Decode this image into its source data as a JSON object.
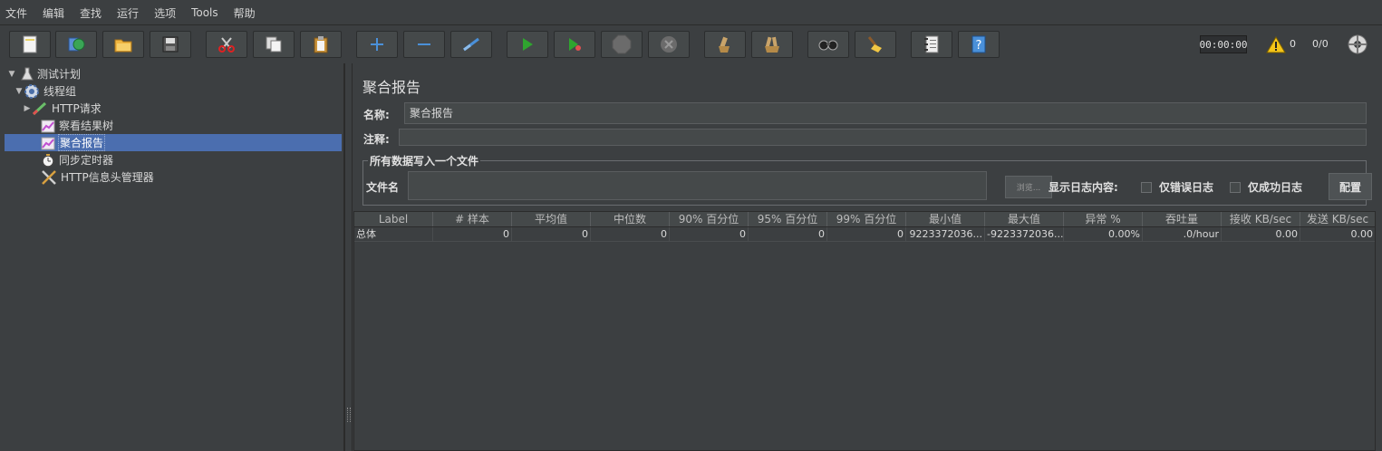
{
  "menu": [
    "文件",
    "编辑",
    "查找",
    "运行",
    "选项",
    "Tools",
    "帮助"
  ],
  "toolbar": {
    "buttons": [
      {
        "name": "new-icon"
      },
      {
        "name": "templates-icon"
      },
      {
        "name": "open-icon"
      },
      {
        "name": "save-icon"
      },
      {
        "name": "cut-icon"
      },
      {
        "name": "copy-icon"
      },
      {
        "name": "paste-icon"
      },
      {
        "name": "expand-icon"
      },
      {
        "name": "collapse-icon"
      },
      {
        "name": "toggle-icon"
      },
      {
        "name": "start-icon"
      },
      {
        "name": "start-no-pauses-icon"
      },
      {
        "name": "stop-icon"
      },
      {
        "name": "shutdown-icon"
      },
      {
        "name": "clear-icon"
      },
      {
        "name": "clear-all-icon"
      },
      {
        "name": "search-icon"
      },
      {
        "name": "reset-search-icon"
      },
      {
        "name": "function-helper-icon"
      },
      {
        "name": "help-icon"
      }
    ],
    "timer": "00:00:00",
    "warning_count": "0",
    "threads": "0/0"
  },
  "tree": {
    "items": [
      {
        "label": "测试计划",
        "icon": "flask-icon",
        "level": 0,
        "arrow": "▼"
      },
      {
        "label": "线程组",
        "icon": "gear-icon",
        "level": 1,
        "arrow": "▼"
      },
      {
        "label": "HTTP请求",
        "icon": "pipette-icon",
        "level": 2,
        "arrow": "▶"
      },
      {
        "label": "察看结果树",
        "icon": "chart-icon",
        "level": 2,
        "arrow": ""
      },
      {
        "label": "聚合报告",
        "icon": "chart-icon",
        "level": 2,
        "arrow": "",
        "selected": true
      },
      {
        "label": "同步定时器",
        "icon": "timer-icon",
        "level": 2,
        "arrow": ""
      },
      {
        "label": "HTTP信息头管理器",
        "icon": "wrench-icon",
        "level": 2,
        "arrow": ""
      }
    ]
  },
  "panel": {
    "title": "聚合报告",
    "name_label": "名称:",
    "name_value": "聚合报告",
    "comment_label": "注释:",
    "comment_value": "",
    "file_group_title": "所有数据写入一个文件",
    "filename_label": "文件名",
    "filename_value": "",
    "browse_label": "浏览...",
    "log_label": "显示日志内容:",
    "errors_only_label": "仅错误日志",
    "success_only_label": "仅成功日志",
    "configure_label": "配置"
  },
  "table": {
    "headers": [
      "Label",
      "# 样本",
      "平均值",
      "中位数",
      "90% 百分位",
      "95% 百分位",
      "99% 百分位",
      "最小值",
      "最大值",
      "异常 %",
      "吞吐量",
      "接收 KB/sec",
      "发送 KB/sec"
    ],
    "rows": [
      [
        "总体",
        "0",
        "0",
        "0",
        "0",
        "0",
        "0",
        "9223372036...",
        "-9223372036...",
        "0.00%",
        ".0/hour",
        "0.00",
        "0.00"
      ]
    ]
  },
  "colors": {
    "background": "#3c3f41",
    "selection": "#4b6eaf",
    "accent_green": "#2fa52f",
    "accent_blue": "#4a90d9"
  }
}
